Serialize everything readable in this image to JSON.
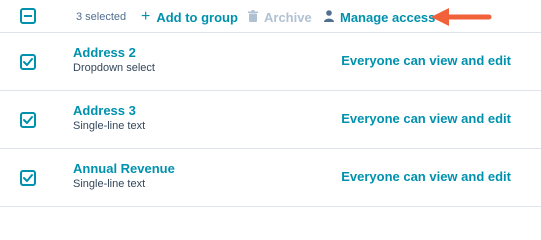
{
  "toolbar": {
    "selected_count": "3 selected",
    "add_to_group": {
      "label": "Add to group",
      "icon": "plus-icon"
    },
    "archive": {
      "label": "Archive",
      "icon": "trash-icon",
      "disabled": true
    },
    "manage_access": {
      "label": "Manage access",
      "icon": "user-icon"
    },
    "select_all_state": "indeterminate"
  },
  "rows": [
    {
      "name": "Address 2",
      "type": "Dropdown select",
      "access": "Everyone can view and edit",
      "checked": true
    },
    {
      "name": "Address 3",
      "type": "Single-line text",
      "access": "Everyone can view and edit",
      "checked": true
    },
    {
      "name": "Annual Revenue",
      "type": "Single-line text",
      "access": "Everyone can view and edit",
      "checked": true
    }
  ],
  "annotation": {
    "icon": "arrow-left-icon",
    "color": "#f2623a"
  },
  "colors": {
    "accent": "#0091ae",
    "disabled": "#b0c1d4",
    "text": "#33475b",
    "border": "#dfe3eb"
  }
}
